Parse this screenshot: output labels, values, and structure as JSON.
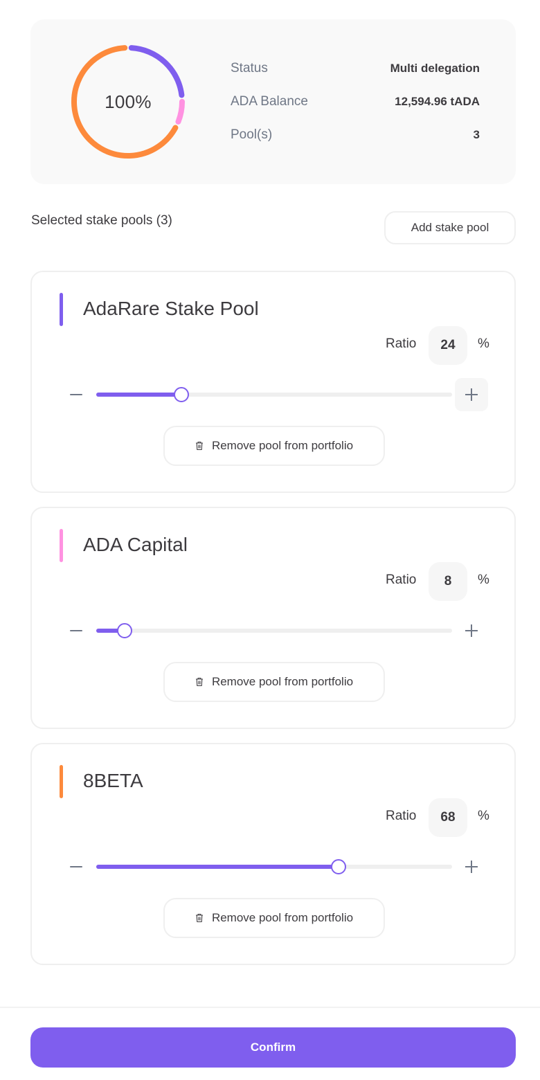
{
  "summary": {
    "total_percent_label": "100%",
    "rows": [
      {
        "label": "Status",
        "value": "Multi delegation"
      },
      {
        "label": "ADA Balance",
        "value": "12,594.96 tADA"
      },
      {
        "label": "Pool(s)",
        "value": "3"
      }
    ]
  },
  "section": {
    "title": "Selected stake pools (3)",
    "add_button_label": "Add stake pool"
  },
  "colors": {
    "accent": "#7f5eee",
    "pool_colors": [
      "#7f5eee",
      "#ff92e1",
      "#fd8a3c"
    ]
  },
  "pools": [
    {
      "name": "AdaRare Stake Pool",
      "color": "#7f5eee",
      "ratio_label": "Ratio",
      "ratio": 24,
      "ratio_display": "24",
      "percent_sign": "%",
      "remove_label": "Remove pool from portfolio"
    },
    {
      "name": "ADA Capital",
      "color": "#ff92e1",
      "ratio_label": "Ratio",
      "ratio": 8,
      "ratio_display": "8",
      "percent_sign": "%",
      "remove_label": "Remove pool from portfolio"
    },
    {
      "name": "8BETA",
      "color": "#fd8a3c",
      "ratio_label": "Ratio",
      "ratio": 68,
      "ratio_display": "68",
      "percent_sign": "%",
      "remove_label": "Remove pool from portfolio"
    }
  ],
  "footer": {
    "confirm_label": "Confirm"
  }
}
